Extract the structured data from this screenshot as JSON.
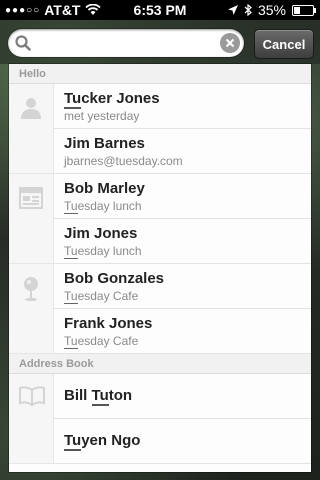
{
  "status_bar": {
    "carrier": "AT&T",
    "time": "6:53 PM",
    "battery_text": "35%",
    "battery_level": 0.35,
    "icons": [
      "signal-dots-icon",
      "wifi-icon",
      "location-arrow-icon",
      "bluetooth-icon",
      "battery-icon"
    ]
  },
  "search": {
    "value": "",
    "placeholder": "",
    "cancel_label": "Cancel"
  },
  "sections": [
    {
      "title": "Hello",
      "groups": [
        {
          "icon": "person-icon",
          "rows": [
            {
              "name_mark": "Tu",
              "name_rest": "cker Jones",
              "sub": "met yesterday"
            },
            {
              "name": "Jim Barnes",
              "sub": "jbarnes@tuesday.com"
            }
          ]
        },
        {
          "icon": "calendar-icon",
          "rows": [
            {
              "name": "Bob Marley",
              "sub_mark": "Tu",
              "sub_rest": "esday lunch"
            },
            {
              "name": "Jim Jones",
              "sub_mark": "Tu",
              "sub_rest": "esday lunch"
            }
          ]
        },
        {
          "icon": "map-pin-icon",
          "rows": [
            {
              "name": "Bob Gonzales",
              "sub_mark": "Tu",
              "sub_rest": "esday Cafe"
            },
            {
              "name": "Frank Jones",
              "sub_mark": "Tu",
              "sub_rest": "esday Cafe"
            }
          ]
        }
      ]
    },
    {
      "title": "Address Book",
      "groups": [
        {
          "icon": "book-icon",
          "rows": [
            {
              "name_pre": "Bill ",
              "name_mark": "Tu",
              "name_rest": "ton"
            },
            {
              "name_mark": "Tu",
              "name_rest": "yen Ngo"
            }
          ]
        }
      ]
    }
  ]
}
